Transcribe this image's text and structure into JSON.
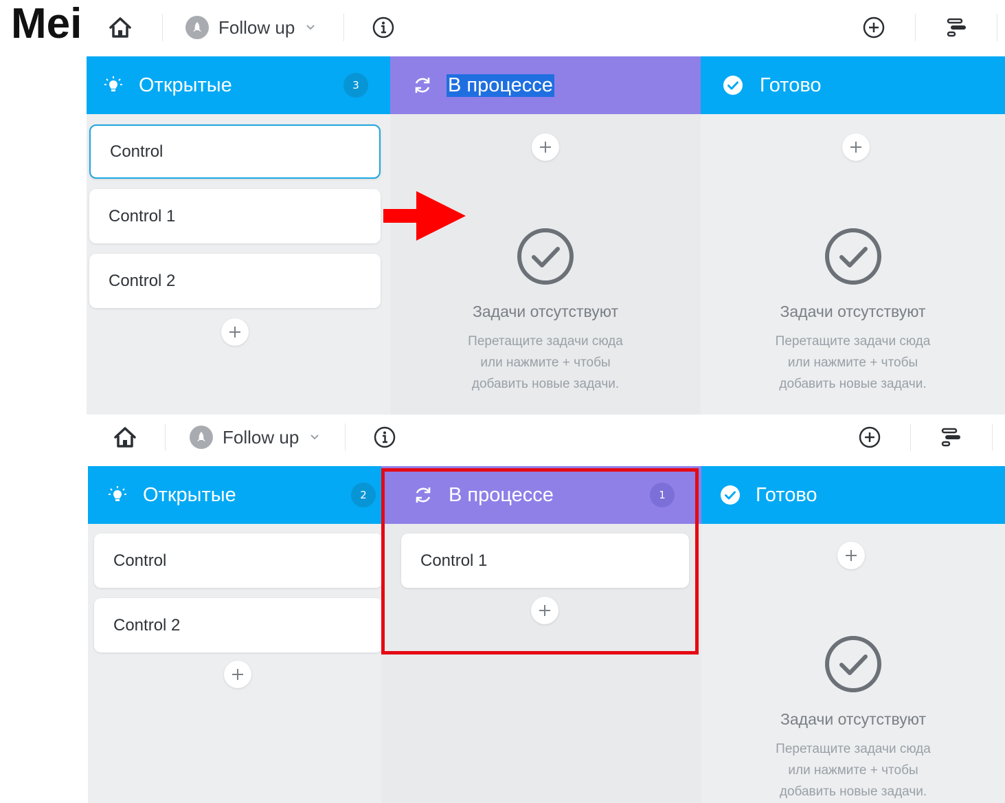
{
  "overlay_title": "Mei",
  "top_panel": {
    "project_name": "Follow up",
    "columns": [
      {
        "title": "Открытые",
        "count": "3",
        "icon": "lightbulb-icon",
        "color": "#03a9f4"
      },
      {
        "title": "В процессе",
        "count": "",
        "icon": "refresh-icon",
        "color": "#8f80e8"
      },
      {
        "title": "Готово",
        "count": "",
        "icon": "check-circle-icon",
        "color": "#03a9f4"
      }
    ],
    "open_cards": [
      "Control",
      "Control 1",
      "Control 2"
    ],
    "empty_state": {
      "title": "Задачи отсутствуют",
      "hint_line1": "Перетащите задачи сюда",
      "hint_line2": "или нажмите + чтобы",
      "hint_line3": "добавить новые задачи."
    }
  },
  "bottom_panel": {
    "project_name": "Follow up",
    "columns": [
      {
        "title": "Открытые",
        "count": "2",
        "icon": "lightbulb-icon",
        "color": "#03a9f4"
      },
      {
        "title": "В процессе",
        "count": "1",
        "icon": "refresh-icon",
        "color": "#8f80e8"
      },
      {
        "title": "Готово",
        "count": "",
        "icon": "check-circle-icon",
        "color": "#03a9f4"
      }
    ],
    "open_cards": [
      "Control",
      "Control 2"
    ],
    "in_progress_cards": [
      "Control 1"
    ],
    "empty_state": {
      "title": "Задачи отсутствуют",
      "hint_line1": "Перетащите задачи сюда",
      "hint_line2": "или нажмите + чтобы",
      "hint_line3": "добавить новые задачи."
    }
  },
  "annotations": {
    "arrow_color": "#ff0000",
    "box_color": "#e50914"
  }
}
